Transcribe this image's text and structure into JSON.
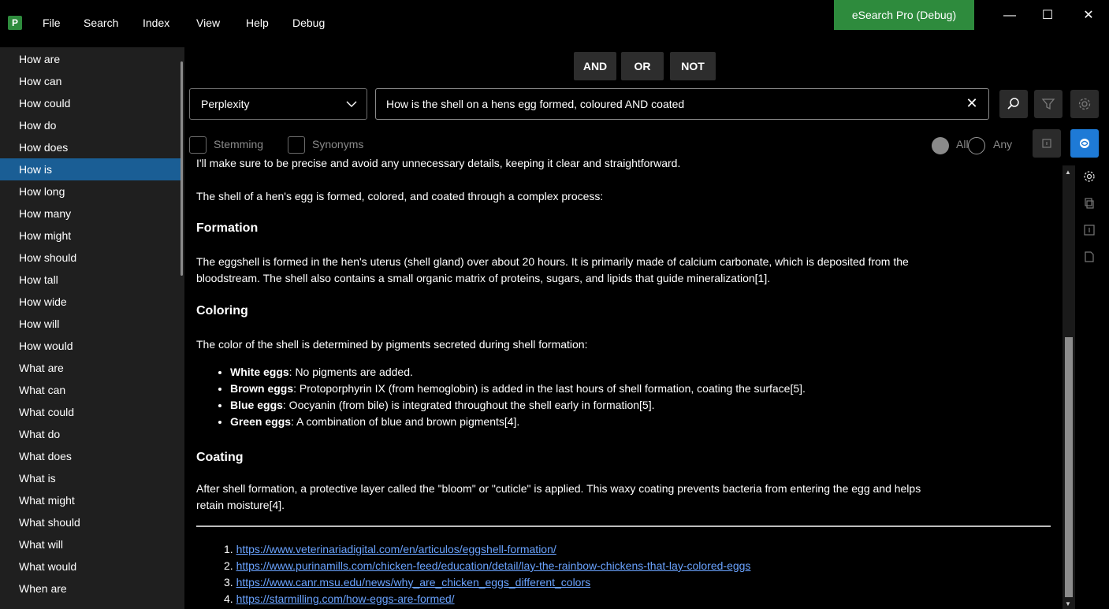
{
  "menu": {
    "file": "File",
    "search": "Search",
    "index": "Index",
    "view": "View",
    "help": "Help",
    "debug": "Debug"
  },
  "app_badge": "eSearch Pro (Debug)",
  "window_controls": {
    "minimize": "—",
    "maximize": "☐",
    "close": "✕"
  },
  "sidebar": {
    "items": [
      "How are",
      "How can",
      "How could",
      "How do",
      "How does",
      "How is",
      "How long",
      "How many",
      "How might",
      "How should",
      "How tall",
      "How wide",
      "How will",
      "How would",
      "What are",
      "What can",
      "What could",
      "What do",
      "What does",
      "What is",
      "What might",
      "What should",
      "What will",
      "What would",
      "When are"
    ],
    "selected": "How is"
  },
  "operators": {
    "and": "AND",
    "or": "OR",
    "not": "NOT"
  },
  "search": {
    "engine": "Perplexity",
    "query": "How is the shell on a hens egg formed, coloured AND coated",
    "clear": "✕"
  },
  "options": {
    "stemming": "Stemming",
    "synonyms": "Synonyms",
    "all": "All",
    "any": "Any",
    "match_mode": "All"
  },
  "result": {
    "cut_line": "I'll make sure to be precise and avoid any unnecessary details, keeping it clear and straightforward.",
    "intro": "The shell of a hen's egg is formed, colored, and coated through a complex process:",
    "formation_heading": "Formation",
    "formation_text_1": "The eggshell is formed in the hen's uterus (shell gland) over about 20 hours. It is primarily made of calcium carbonate, which is deposited from the",
    "formation_text_2": "bloodstream. The shell also contains a small organic matrix of proteins, sugars, and lipids that guide mineralization[1].",
    "coloring_heading": "Coloring",
    "coloring_text": "The color of the shell is determined by pigments secreted during shell formation:",
    "bullets": [
      {
        "term": "White eggs",
        "text": ": No pigments are added."
      },
      {
        "term": "Brown eggs",
        "text": ": Protoporphyrin IX (from hemoglobin) is added in the last hours of shell formation, coating the surface[5]."
      },
      {
        "term": "Blue eggs",
        "text": ": Oocyanin (from bile) is integrated throughout the shell early in formation[5]."
      },
      {
        "term": "Green eggs",
        "text": ": A combination of blue and brown pigments[4]."
      }
    ],
    "coating_heading": "Coating",
    "coating_text_1": "After shell formation, a protective layer called the \"bloom\" or \"cuticle\" is applied. This waxy coating prevents bacteria from entering the egg and helps",
    "coating_text_2": "retain moisture[4].",
    "references": [
      {
        "num": "1.",
        "url": "https://www.veterinariadigital.com/en/articulos/eggshell-formation/"
      },
      {
        "num": "2.",
        "url": "https://www.purinamills.com/chicken-feed/education/detail/lay-the-rainbow-chickens-that-lay-colored-eggs"
      },
      {
        "num": "3.",
        "url": "https://www.canr.msu.edu/news/why_are_chicken_eggs_different_colors"
      },
      {
        "num": "4.",
        "url": "https://starmilling.com/how-eggs-are-formed/"
      }
    ]
  },
  "colors": {
    "accent_green": "#2e8b3d",
    "selection_blue": "#1a5e95",
    "link_blue": "#6aa3ff",
    "ai_button_blue": "#1e7ad6"
  }
}
